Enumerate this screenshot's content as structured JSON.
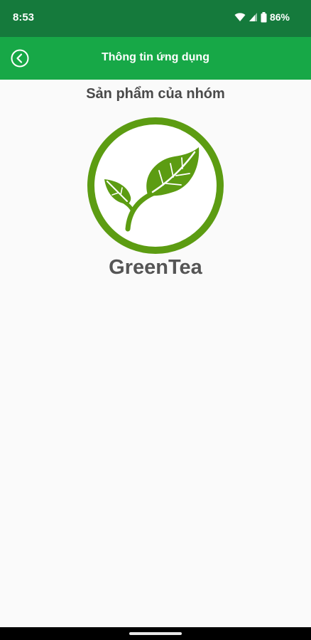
{
  "status_bar": {
    "time": "8:53",
    "battery": "86%",
    "icons": [
      "wifi-icon",
      "signal-icon",
      "battery-icon"
    ]
  },
  "app_bar": {
    "title": "Thông tin ứng dụng",
    "back_icon": "back-icon"
  },
  "content": {
    "group_label": "Sản phẩm của nhóm",
    "logo_icon": "leaf-logo-icon",
    "product_name": "GreenTea"
  },
  "colors": {
    "status_bar": "#157a3c",
    "app_bar": "#17a847",
    "logo_green": "#5c9c12",
    "background": "#fafafa"
  }
}
